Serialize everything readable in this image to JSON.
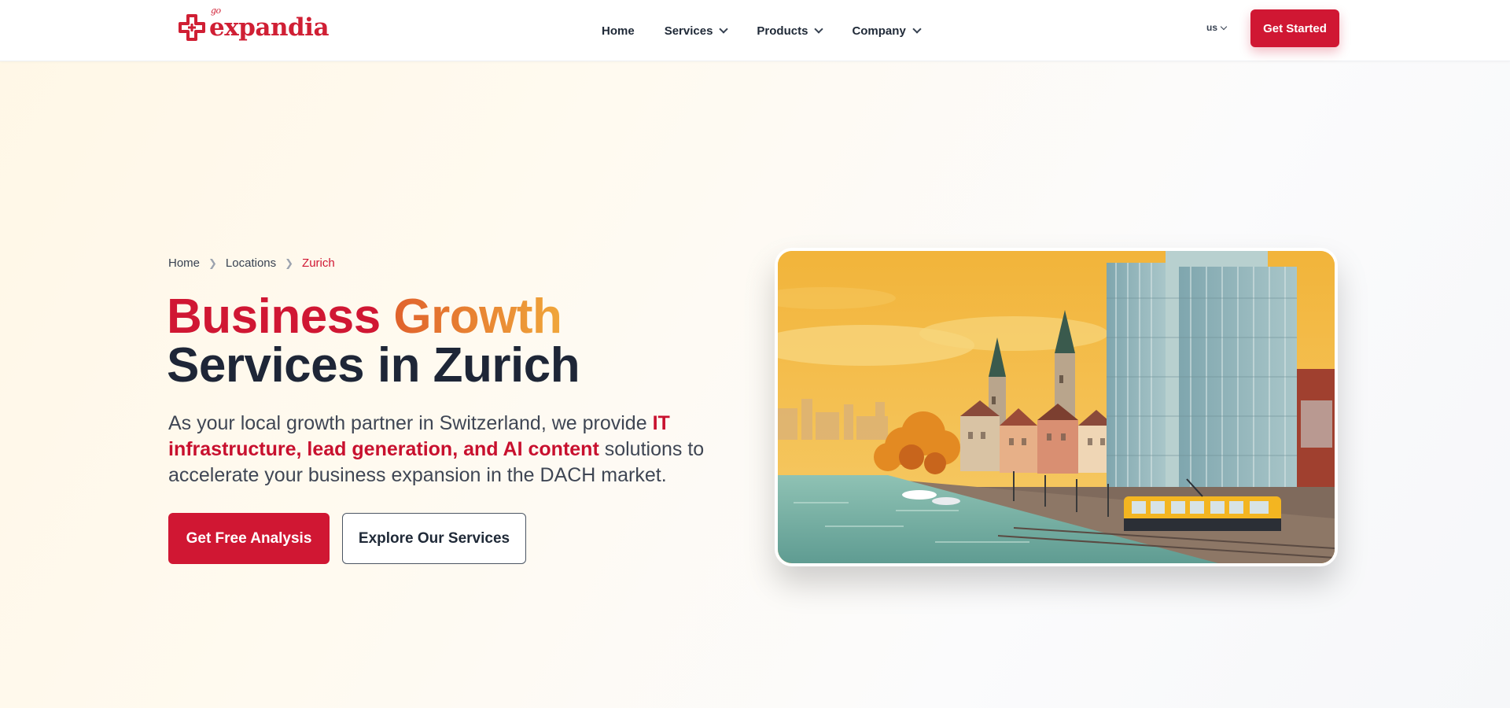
{
  "header": {
    "logo": {
      "brand": "expandia",
      "mark": "cross-logo-icon",
      "tag": "go"
    },
    "nav": [
      {
        "label": "Home",
        "has_dropdown": false
      },
      {
        "label": "Services",
        "has_dropdown": true
      },
      {
        "label": "Products",
        "has_dropdown": true
      },
      {
        "label": "Company",
        "has_dropdown": true
      }
    ],
    "language": "us",
    "cta_label": "Get Started"
  },
  "hero": {
    "breadcrumb": [
      {
        "label": "Home"
      },
      {
        "label": "Locations"
      },
      {
        "label": "Zurich",
        "current": true
      }
    ],
    "headline": {
      "word_1": "Business",
      "word_2": "Growth",
      "line_2": "Services in Zurich"
    },
    "lead": {
      "before": "As your local growth partner in Switzerland, we provide ",
      "highlight": "IT infrastructure, lead generation, and AI content",
      "after": " solutions to accelerate your business expansion in the DACH market."
    },
    "primary_cta": "Get Free Analysis",
    "secondary_cta": "Explore Our Services",
    "image": {
      "subject": "zurich-illustration"
    }
  },
  "colors": {
    "brand_red": "#d01733",
    "accent_orange": "#ea7c2f",
    "accent_gold": "#f0a63a",
    "heading_dark": "#1e2637"
  }
}
